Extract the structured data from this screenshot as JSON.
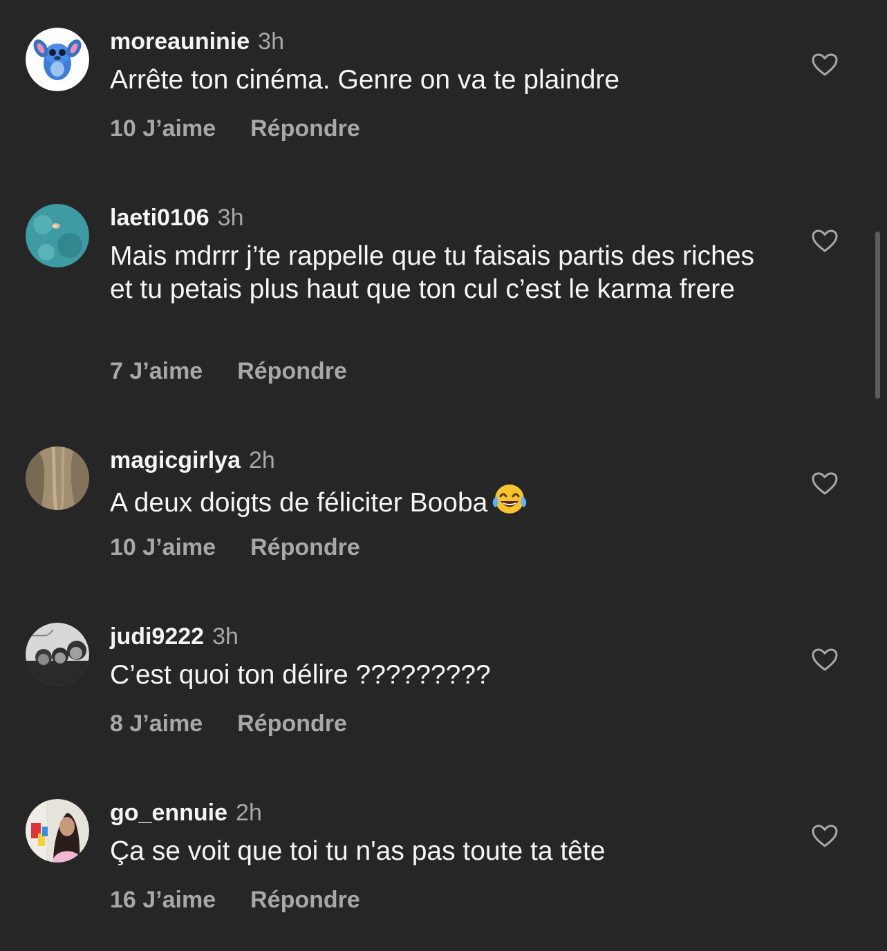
{
  "comments": [
    {
      "username": "moreauninie",
      "time": "3h",
      "text": "Arrête ton cinéma. Genre on va te plaindre",
      "likes": "10 J’aime",
      "reply": "Répondre",
      "avatar_icon": "stitch-avatar"
    },
    {
      "username": "laeti0106",
      "time": "3h",
      "text": "Mais mdrrr j’te rappelle que tu faisais partis des riches et tu petais plus haut que ton cul c’est le karma frere",
      "likes": "7 J’aime",
      "reply": "Répondre",
      "avatar_icon": "pool-avatar"
    },
    {
      "username": "magicgirlya",
      "time": "2h",
      "text": "A deux doigts de féliciter Booba",
      "emoji": "tears-of-joy",
      "likes": "10 J’aime",
      "reply": "Répondre",
      "avatar_icon": "hair-avatar"
    },
    {
      "username": "judi9222",
      "time": "3h",
      "text": "C’est quoi ton délire ?????????",
      "likes": "8 J’aime",
      "reply": "Répondre",
      "avatar_icon": "bw-photo-avatar"
    },
    {
      "username": "go_ennuie",
      "time": "2h",
      "text": "Ça se voit que toi tu n'as pas toute ta tête",
      "likes": "16 J’aime",
      "reply": "Répondre",
      "avatar_icon": "selfie-avatar"
    }
  ],
  "icons": {
    "like": "heart-outline-icon"
  },
  "colors": {
    "background": "#262626",
    "primary_text": "#f5f5f5",
    "secondary_text": "#a8a8a8"
  }
}
